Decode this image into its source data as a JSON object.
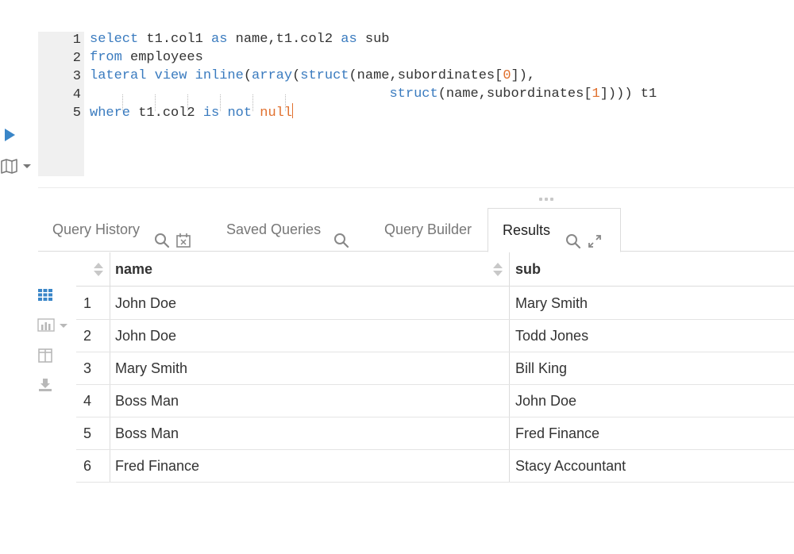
{
  "editor": {
    "line_numbers": [
      "1",
      "2",
      "3",
      "4",
      "5"
    ],
    "lines": [
      [
        {
          "t": "select",
          "c": "kw"
        },
        {
          "t": " t1.col1 ",
          "c": ""
        },
        {
          "t": "as",
          "c": "kw"
        },
        {
          "t": " name,t1.col2 ",
          "c": ""
        },
        {
          "t": "as",
          "c": "kw"
        },
        {
          "t": " sub",
          "c": ""
        }
      ],
      [
        {
          "t": "from",
          "c": "kw"
        },
        {
          "t": " employees",
          "c": ""
        }
      ],
      [
        {
          "t": "lateral view inline",
          "c": "kw"
        },
        {
          "t": "(",
          "c": ""
        },
        {
          "t": "array",
          "c": "kw"
        },
        {
          "t": "(",
          "c": ""
        },
        {
          "t": "struct",
          "c": "kw"
        },
        {
          "t": "(name,subordinates[",
          "c": ""
        },
        {
          "t": "0",
          "c": "num"
        },
        {
          "t": "]),",
          "c": ""
        }
      ],
      [
        {
          "t": "                                     ",
          "c": ""
        },
        {
          "t": "struct",
          "c": "kw"
        },
        {
          "t": "(name,subordinates[",
          "c": ""
        },
        {
          "t": "1",
          "c": "num"
        },
        {
          "t": "]))) t1",
          "c": ""
        }
      ],
      [
        {
          "t": "where",
          "c": "kw"
        },
        {
          "t": " t1.col2 ",
          "c": ""
        },
        {
          "t": "is not",
          "c": "kw"
        },
        {
          "t": " ",
          "c": ""
        },
        {
          "t": "null",
          "c": "nul"
        }
      ]
    ]
  },
  "tabs": {
    "query_history": "Query History",
    "saved_queries": "Saved Queries",
    "query_builder": "Query Builder",
    "results": "Results"
  },
  "results": {
    "columns": [
      "name",
      "sub"
    ],
    "rows": [
      [
        "1",
        "John Doe",
        "Mary Smith"
      ],
      [
        "2",
        "John Doe",
        "Todd Jones"
      ],
      [
        "3",
        "Mary Smith",
        "Bill King"
      ],
      [
        "4",
        "Boss Man",
        "John Doe"
      ],
      [
        "5",
        "Boss Man",
        "Fred Finance"
      ],
      [
        "6",
        "Fred Finance",
        "Stacy Accountant"
      ]
    ]
  },
  "colors": {
    "keyword": "#3a7bbf",
    "literal": "#e0702e",
    "run_button": "#3a86c8"
  },
  "icons": [
    "play-icon",
    "map-icon",
    "search-icon",
    "calendar-icon",
    "expand-icon",
    "grid-icon",
    "bar-chart-icon",
    "columns-icon",
    "download-icon",
    "sort-icon"
  ]
}
